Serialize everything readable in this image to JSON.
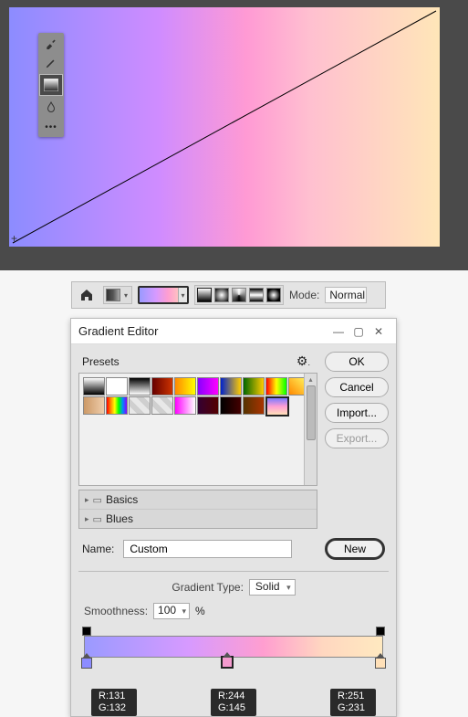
{
  "tools": [
    {
      "name": "brush-tool",
      "icon": "brush"
    },
    {
      "name": "pencil-tool",
      "icon": "pencil"
    },
    {
      "name": "gradient-tool",
      "icon": "gradient"
    },
    {
      "name": "drop-tool",
      "icon": "drop"
    },
    {
      "name": "more-tool",
      "icon": "dots"
    }
  ],
  "options_bar": {
    "mode_label": "Mode:",
    "mode_value": "Normal"
  },
  "dialog": {
    "title": "Gradient Editor",
    "presets_label": "Presets",
    "folders": [
      {
        "label": "Basics"
      },
      {
        "label": "Blues"
      }
    ],
    "buttons": {
      "ok": "OK",
      "cancel": "Cancel",
      "import": "Import...",
      "export": "Export..."
    },
    "name_label": "Name:",
    "name_value": "Custom",
    "new_label": "New",
    "gradient_type_label": "Gradient Type:",
    "gradient_type_value": "Solid",
    "smoothness_label": "Smoothness:",
    "smoothness_value": "100",
    "smoothness_unit": "%"
  },
  "readouts": {
    "left": {
      "r": "R:131",
      "g": "G:132"
    },
    "mid": {
      "r": "R:244",
      "g": "G:145"
    },
    "right": {
      "r": "R:251",
      "g": "G:231"
    }
  },
  "preset_gradients": [
    "linear-gradient(180deg,#fff,#000)",
    "linear-gradient(180deg,#fff,#fff)",
    "linear-gradient(180deg,#000,#fff)",
    "linear-gradient(90deg,#660000,#cc3300)",
    "linear-gradient(90deg,#ff8800,#ffff00)",
    "linear-gradient(90deg,#8800ff,#ff00ff)",
    "linear-gradient(90deg,#0022cc,#ffcc00)",
    "linear-gradient(90deg,#006600,#ffcc00)",
    "linear-gradient(90deg,#ff0000,#ffff00,#00ff00)",
    "linear-gradient(45deg,#ff8800,#ffff66)",
    "linear-gradient(90deg,#cc9966,#eeccaa)",
    "linear-gradient(90deg,#ff0000,#ff8800,#ffff00,#00ff00,#0088ff,#8800ff)",
    "repeating-linear-gradient(45deg,#e8e8e8 0 6px,#cfcfcf 6px 12px)",
    "repeating-linear-gradient(45deg,#e8e8e8 0 6px,#cfcfcf 6px 12px)",
    "linear-gradient(90deg,#ff00ff,#ffffff)",
    "linear-gradient(90deg,#330033,#550000)",
    "linear-gradient(90deg,#000,#440000)",
    "linear-gradient(90deg,#553300,#aa3300)",
    "linear-gradient(180deg,#7a7aff,#ff9ed4,#ffe0b8)"
  ]
}
